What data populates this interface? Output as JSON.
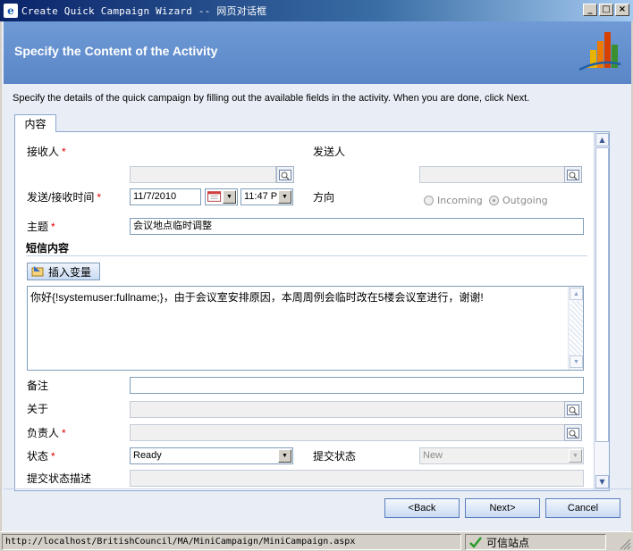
{
  "window": {
    "title": "Create Quick Campaign Wizard -- 网页对话框",
    "minimize": "_",
    "maximize": "□",
    "close": "×"
  },
  "header": {
    "title": "Specify the Content of the Activity"
  },
  "intro": "Specify the details of the quick campaign by filling out the available fields in the activity. When you are done, click Next.",
  "tab": {
    "label": "内容"
  },
  "form": {
    "recipient_label": "接收人",
    "sender_label": "发送人",
    "send_time_label": "发送/接收时间",
    "date_value": "11/7/2010",
    "time_value": "11:47 P",
    "direction_label": "方向",
    "incoming_label": "Incoming",
    "outgoing_label": "Outgoing",
    "subject_label": "主题",
    "subject_value": "会议地点临时调整",
    "section_title": "短信内容",
    "insert_variable_label": "插入变量",
    "message_body": "你好{!systemuser:fullname;}，由于会议室安排原因，本周周例会临时改在5楼会议室进行，谢谢!",
    "notes_label": "备注",
    "regarding_label": "关于",
    "owner_label": "负责人",
    "status_label": "状态",
    "status_value": "Ready",
    "submit_status_label": "提交状态",
    "submit_status_value": "New",
    "submit_status_desc_label": "提交状态描述",
    "required_mark": "*"
  },
  "buttons": {
    "back": "<Back",
    "next": "Next>",
    "cancel": "Cancel"
  },
  "statusbar": {
    "url": "http://localhost/BritishCouncil/MA/MiniCampaign/MiniCampaign.aspx",
    "zone": "可信站点"
  },
  "colors": {
    "header": "#6f9ad6",
    "required": "#dd0000",
    "titlebar": "#0a246a"
  }
}
